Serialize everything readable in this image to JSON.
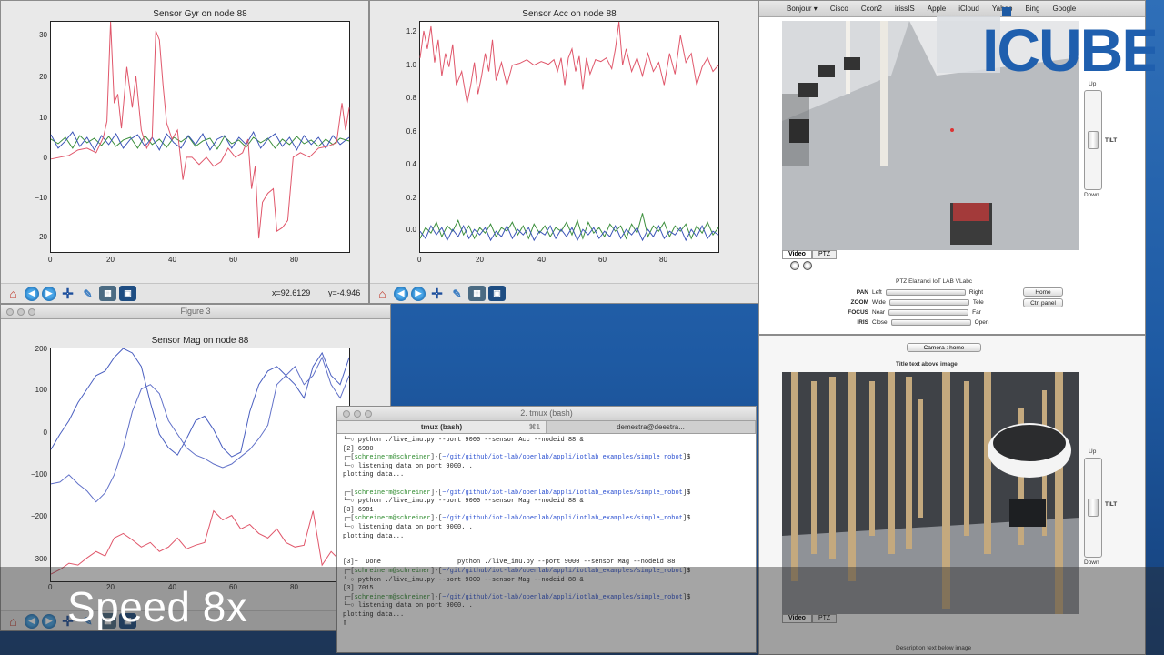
{
  "charts": {
    "gyr": {
      "title": "Sensor Gyr on node 88",
      "yticks": [
        "30",
        "20",
        "10",
        "0",
        "−10",
        "−20"
      ],
      "xticks": [
        "0",
        "20",
        "40",
        "60",
        "80"
      ]
    },
    "acc": {
      "title": "Sensor Acc on node 88",
      "yticks": [
        "1.2",
        "1.0",
        "0.8",
        "0.6",
        "0.4",
        "0.2",
        "0.0"
      ],
      "xticks": [
        "0",
        "20",
        "40",
        "60",
        "80"
      ]
    },
    "mag": {
      "title": "Sensor Mag on node 88",
      "window_title": "Figure 3",
      "yticks": [
        "200",
        "100",
        "0",
        "−100",
        "−200",
        "−300"
      ],
      "xticks": [
        "0",
        "20",
        "40",
        "60",
        "80"
      ]
    }
  },
  "toolbar": {
    "coord_x": "x=92.6129",
    "coord_y": "y=-4.946"
  },
  "terminal": {
    "window_title": "2. tmux (bash)",
    "tab1": "tmux (bash)",
    "tab2": "demestra@deestra...",
    "tab_close": "⌘1",
    "lines_1": [
      "└─○ python ./live_imu.py --port 9000 --sensor Acc --nodeid 88 &",
      "[2] 6980",
      "┌─[",
      "└─○ listening data on port 9000...",
      "plotting data..."
    ],
    "user": "schreinerm@schreiner",
    "path": "~/git/github/iot-lab/openlab/appli/iotlab_examples/simple_robot",
    "lines_2": [
      "└─○ python ./live_imu.py --port 9000 --sensor Mag --nodeid 88 &",
      "[3] 6981"
    ],
    "lines_3": [
      "└─○ listening data on port 9000...",
      "plotting data..."
    ],
    "lines_4": [
      "[3]+  Done                    python ./live_imu.py --port 9000 --sensor Mag --nodeid 88",
      "└─○ python ./live_imu.py --port 9000 --sensor Mag --nodeid 88 &",
      "[3] 7015"
    ],
    "lines_5": [
      "└─○ listening data on port 9000...",
      "plotting data..."
    ]
  },
  "browser": {
    "bookmarks": [
      "Bonjour ▾",
      "Cisco",
      "Ccon2",
      "irissIS",
      "Apple",
      "iCloud",
      "Yahoo",
      "Bing",
      "Google"
    ],
    "tab_video": "Video",
    "tab_ptz": "PTZ",
    "ptz_title": "PTZ Elazanci IoT LAB VLabc",
    "tilt_up": "Up",
    "tilt_label": "TILT",
    "tilt_down": "Down",
    "ptz_rows": [
      {
        "label": "PAN",
        "left": "Left",
        "right": "Right"
      },
      {
        "label": "ZOOM",
        "left": "Wide",
        "right": "Tele"
      },
      {
        "label": "FOCUS",
        "left": "Near",
        "right": "Far"
      },
      {
        "label": "IRIS",
        "left": "Close",
        "right": "Open"
      }
    ],
    "home_btn": "Home",
    "ctrl_btn": "Ctrl panel",
    "camera_select": "Camera : home",
    "cam2_title": "Title text above image",
    "cam2_caption": "Description text below image"
  },
  "logo_text": "ICUBE",
  "speed_label": "Speed 8x",
  "colors": {
    "desktop": "#1e5aa3",
    "series_red": "#e0566a",
    "series_green": "#3c8f3c",
    "series_blue": "#3c55b8"
  }
}
